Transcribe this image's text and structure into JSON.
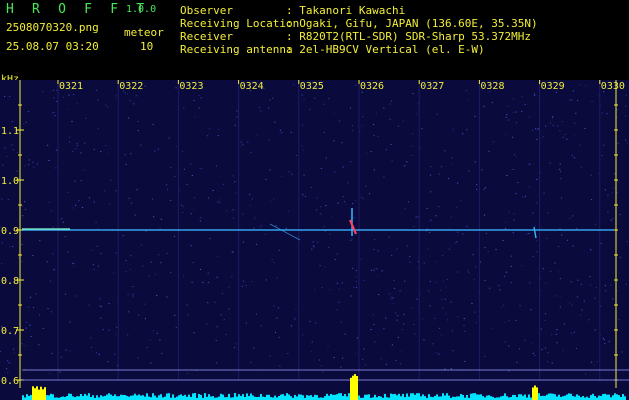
{
  "header": {
    "app_title": "H R O F F T",
    "version": "1.0.0",
    "filename": "2508070320.png",
    "meteor_label": "meteor",
    "meteor_count": "10",
    "timestamp": "25.08.07 03:20"
  },
  "meta": [
    {
      "key": "Observer",
      "value": ": Takanori Kawachi"
    },
    {
      "key": "Receiving Location",
      "value": ": Ogaki, Gifu, JAPAN (136.60E, 35.35N)"
    },
    {
      "key": "Receiver",
      "value": ": R820T2(RTL-SDR) SDR-Sharp 53.372MHz"
    },
    {
      "key": "Receiving antenna",
      "value": ": 2el-HB9CV Vertical (el. E-W)"
    }
  ],
  "spectrogram": {
    "unit_label": "kHz",
    "time_labels": [
      "0321",
      "0322",
      "0323",
      "0324",
      "0325",
      "0326",
      "0327",
      "0328",
      "0329",
      "0330"
    ],
    "freq_labels": [
      "1.1",
      "1.0",
      "0.9",
      "0.8",
      "0.7",
      "0.6"
    ],
    "freq_values": [
      1.1,
      1.0,
      0.9,
      0.8,
      0.7,
      0.6
    ],
    "freq_range": [
      0.58,
      1.16
    ],
    "carrier_khz": 0.9,
    "colors": {
      "background": "#0a0a3c",
      "grid": "#1c1c66",
      "text": "#f2ee3a",
      "title": "#49e65a",
      "signal": "#3ab4ff",
      "level": "#00e5ff",
      "peak": "#ffff00"
    }
  }
}
